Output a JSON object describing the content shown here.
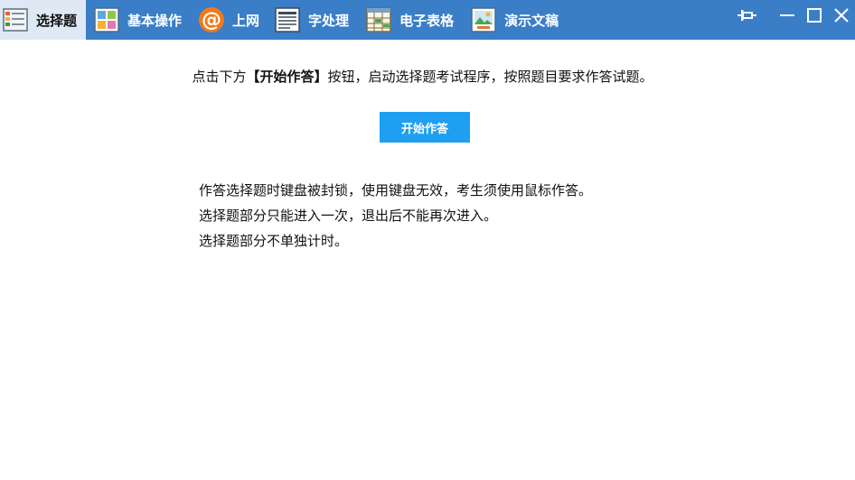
{
  "tabs": [
    {
      "label": "选择题",
      "icon": "choice-question-icon",
      "active": true
    },
    {
      "label": "基本操作",
      "icon": "basic-operation-icon",
      "active": false
    },
    {
      "label": "上网",
      "icon": "internet-at-icon",
      "active": false
    },
    {
      "label": "字处理",
      "icon": "word-processing-icon",
      "active": false
    },
    {
      "label": "电子表格",
      "icon": "spreadsheet-icon",
      "active": false
    },
    {
      "label": "演示文稿",
      "icon": "presentation-icon",
      "active": false
    }
  ],
  "window_controls": [
    "pin-icon",
    "minimize-icon",
    "maximize-icon",
    "close-icon"
  ],
  "colors": {
    "topbar": "#3a7ec8",
    "active_tab": "#dfe9f5",
    "start_button": "#1e9ff2"
  },
  "main": {
    "instruction_prefix": "点击下方",
    "instruction_bold": "【开始作答】",
    "instruction_suffix": "按钮，启动选择题考试程序，按照题目要求作答试题。",
    "start_button_label": "开始作答",
    "notes": [
      "作答选择题时键盘被封锁，使用键盘无效，考生须使用鼠标作答。",
      "选择题部分只能进入一次，退出后不能再次进入。",
      "选择题部分不单独计时。"
    ]
  }
}
